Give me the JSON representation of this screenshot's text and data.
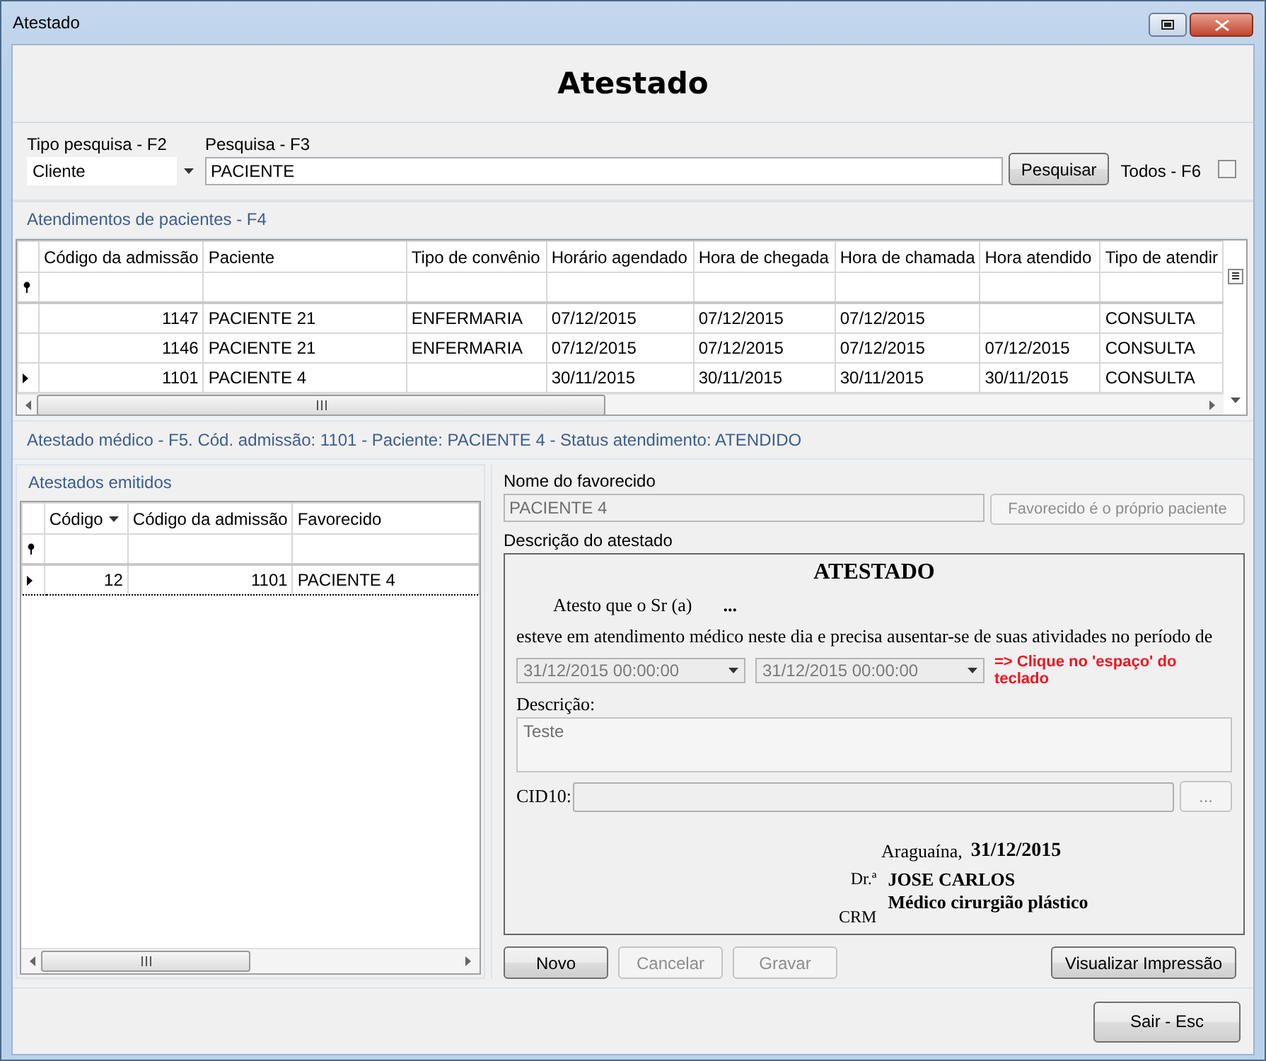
{
  "window": {
    "title": "Atestado"
  },
  "header": {
    "title": "Atestado"
  },
  "search": {
    "type_label": "Tipo pesquisa - F2",
    "type_value": "Cliente",
    "query_label": "Pesquisa - F3",
    "query_value": "PACIENTE",
    "search_button": "Pesquisar",
    "all_label": "Todos - F6",
    "all_checked": false
  },
  "patients": {
    "title": "Atendimentos de pacientes - F4",
    "columns": [
      {
        "label": "Código da admissão",
        "numeric": true
      },
      {
        "label": "Paciente",
        "numeric": false
      },
      {
        "label": "Tipo de convênio",
        "numeric": false
      },
      {
        "label": "Horário agendado",
        "numeric": false
      },
      {
        "label": "Hora de chegada",
        "numeric": false
      },
      {
        "label": "Hora de chamada",
        "numeric": false
      },
      {
        "label": "Hora atendido",
        "numeric": false
      },
      {
        "label": "Tipo de atendir",
        "numeric": false
      }
    ],
    "rows": [
      {
        "selected": false,
        "cells": [
          "1147",
          "PACIENTE 21",
          "ENFERMARIA",
          "07/12/2015",
          "07/12/2015",
          "07/12/2015",
          "",
          "CONSULTA"
        ]
      },
      {
        "selected": false,
        "cells": [
          "1146",
          "PACIENTE 21",
          "ENFERMARIA",
          "07/12/2015",
          "07/12/2015",
          "07/12/2015",
          "07/12/2015",
          "CONSULTA"
        ]
      },
      {
        "selected": true,
        "cells": [
          "1101",
          "PACIENTE 4",
          "",
          "30/11/2015",
          "30/11/2015",
          "30/11/2015",
          "30/11/2015",
          "CONSULTA"
        ]
      }
    ]
  },
  "status_text": "Atestado médico - F5. Cód. admissão: 1101 - Paciente: PACIENTE 4 - Status atendimento: ATENDIDO",
  "certificates": {
    "title": "Atestados emitidos",
    "columns": [
      {
        "label": "Código",
        "numeric": true,
        "sorted": true
      },
      {
        "label": "Código da admissão",
        "numeric": true,
        "sorted": false
      },
      {
        "label": "Favorecido",
        "numeric": false,
        "sorted": false
      }
    ],
    "rows": [
      {
        "selected": true,
        "cells": [
          "12",
          "1101",
          "PACIENTE 4"
        ]
      }
    ]
  },
  "form": {
    "favored_label": "Nome do favorecido",
    "favored_value": "PACIENTE 4",
    "own_patient_button": {
      "label": "Favorecido é o próprio paciente",
      "disabled": true
    },
    "description_label": "Descrição do atestado",
    "document": {
      "title": "ATESTADO",
      "attest_text": "Atesto que o Sr (a)",
      "patient_name": "...",
      "period_text": "esteve em atendimento médico neste dia e precisa ausentar-se de suas atividades no período de",
      "date_from": "31/12/2015 00:00:00",
      "date_to": "31/12/2015 00:00:00",
      "hint": "=> Clique no 'espaço' do teclado",
      "desc_label": "Descrição:",
      "desc_value": "Teste",
      "cid_label": "CID10:",
      "cid_button": "...",
      "city": "Araguaína,",
      "date": "31/12/2015",
      "dr_label": "Dr.ª",
      "doctor_name": "JOSE CARLOS",
      "specialty": "Médico cirurgião plástico",
      "crm_label": "CRM"
    }
  },
  "buttons": [
    {
      "label": "Novo",
      "disabled": false
    },
    {
      "label": "Cancelar",
      "disabled": true
    },
    {
      "label": "Gravar",
      "disabled": true
    }
  ],
  "print_button": "Visualizar Impressão",
  "exit_button": "Sair - Esc"
}
